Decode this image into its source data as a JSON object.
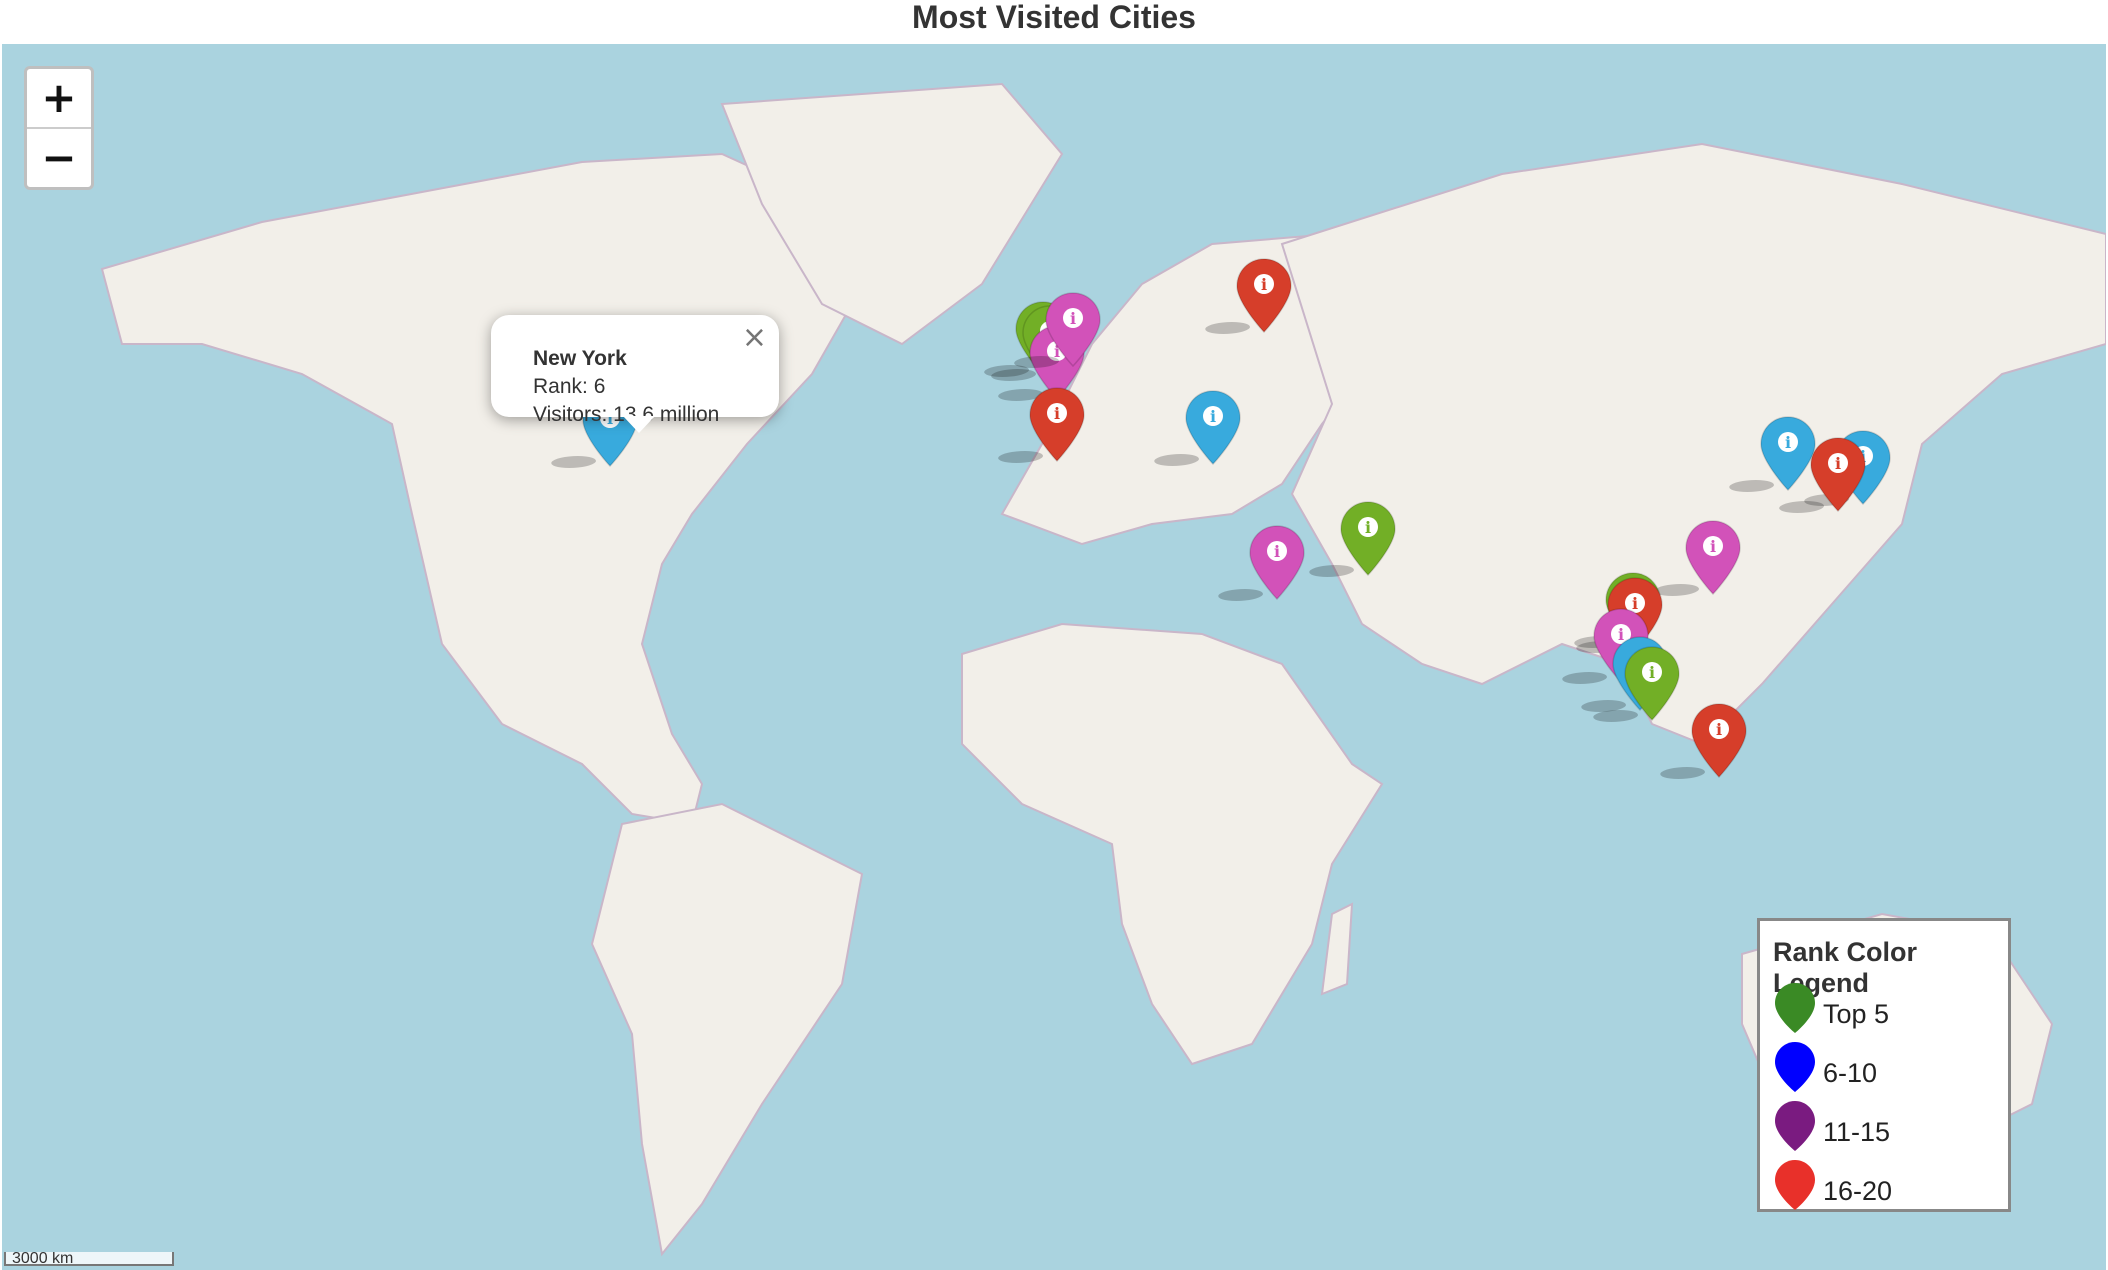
{
  "title": "Most Visited Cities",
  "zoom": {
    "in_label": "+",
    "out_label": "−"
  },
  "popup": {
    "city": "New York",
    "rank_line": "Rank: 6",
    "visitors_line": "Visitors: 13.6 million",
    "close_label": "×"
  },
  "legend": {
    "title": "Rank Color Legend",
    "items": [
      {
        "label": "Top 5",
        "color": "#3a8a25"
      },
      {
        "label": "6-10",
        "color": "#0000ff"
      },
      {
        "label": "11-15",
        "color": "#7a1b80"
      },
      {
        "label": "16-20",
        "color": "#e8302a"
      }
    ]
  },
  "scale_label": "3000 km",
  "marker_colors": {
    "green": "#72af26",
    "blue": "#38aadd",
    "purple": "#d252b9",
    "red": "#d63e2a"
  },
  "markers": [
    {
      "name": "marker-london-1",
      "color": "green",
      "lat": 51.5,
      "lon": -0.1
    },
    {
      "name": "marker-london-2",
      "color": "green",
      "lat": 51.0,
      "lon": 1.0
    },
    {
      "name": "marker-paris",
      "color": "purple",
      "lat": 48.8,
      "lon": 2.3
    },
    {
      "name": "marker-amsterdam",
      "color": "purple",
      "lat": 52.4,
      "lon": 4.9
    },
    {
      "name": "marker-barcelona",
      "color": "red",
      "lat": 41.4,
      "lon": 2.2
    },
    {
      "name": "marker-istanbul",
      "color": "blue",
      "lat": 41.0,
      "lon": 28.9
    },
    {
      "name": "marker-moscow",
      "color": "red",
      "lat": 55.8,
      "lon": 37.6
    },
    {
      "name": "marker-mecca",
      "color": "purple",
      "lat": 21.4,
      "lon": 39.8
    },
    {
      "name": "marker-dubai",
      "color": "green",
      "lat": 25.2,
      "lon": 55.3
    },
    {
      "name": "marker-new-york",
      "color": "blue",
      "lat": 40.7,
      "lon": -74.0
    },
    {
      "name": "marker-seoul",
      "color": "blue",
      "lat": 37.6,
      "lon": 127.0
    },
    {
      "name": "marker-tokyo",
      "color": "blue",
      "lat": 35.7,
      "lon": 139.7
    },
    {
      "name": "marker-osaka",
      "color": "red",
      "lat": 34.7,
      "lon": 135.5
    },
    {
      "name": "marker-hong-kong",
      "color": "purple",
      "lat": 22.3,
      "lon": 114.2
    },
    {
      "name": "marker-bangkok-1",
      "color": "green",
      "lat": 13.8,
      "lon": 100.5
    },
    {
      "name": "marker-bangkok-2",
      "color": "red",
      "lat": 13.0,
      "lon": 100.9
    },
    {
      "name": "marker-phuket",
      "color": "purple",
      "lat": 7.9,
      "lon": 98.4
    },
    {
      "name": "marker-kuala-lumpur",
      "color": "blue",
      "lat": 3.1,
      "lon": 101.7
    },
    {
      "name": "marker-singapore",
      "color": "green",
      "lat": 1.3,
      "lon": 103.8
    },
    {
      "name": "marker-bali",
      "color": "red",
      "lat": -8.4,
      "lon": 115.2
    }
  ]
}
